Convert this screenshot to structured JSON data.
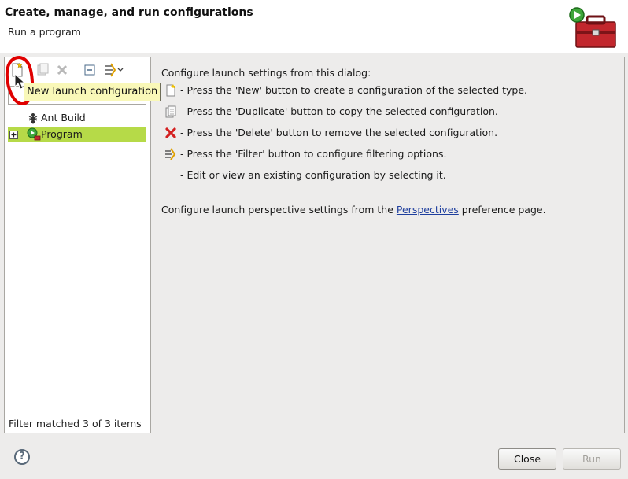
{
  "header": {
    "title": "Create, manage, and run configurations",
    "subtitle": "Run a program"
  },
  "toolbar": {
    "tooltip": "New launch configuration",
    "icons": [
      "new-config-icon",
      "duplicate-icon",
      "delete-icon",
      "collapse-all-icon",
      "filter-icon"
    ]
  },
  "tree": {
    "items": [
      {
        "label": "Ant Build",
        "icon": "ant-icon",
        "selected": false
      },
      {
        "label": "Program",
        "icon": "program-launch-icon",
        "selected": true,
        "expandable": true
      }
    ],
    "filter_status": "Filter matched 3 of 3 items"
  },
  "info": {
    "intro": "Configure launch settings from this dialog:",
    "lines": [
      {
        "icon": "new-icon",
        "text": "- Press the 'New' button to create a configuration of the selected type."
      },
      {
        "icon": "duplicate-icon",
        "text": "- Press the 'Duplicate' button to copy the selected configuration."
      },
      {
        "icon": "delete-icon",
        "text": "- Press the 'Delete' button to remove the selected configuration."
      },
      {
        "icon": "filter-icon",
        "text": "- Press the 'Filter' button to configure filtering options."
      },
      {
        "icon": "",
        "text": "- Edit or view an existing configuration by selecting it."
      }
    ],
    "perspective_prefix": "Configure launch perspective settings from the ",
    "perspective_link": "Perspectives",
    "perspective_suffix": " preference page."
  },
  "footer": {
    "help": "?",
    "close_label": "Close",
    "run_label": "Run"
  },
  "colors": {
    "selection": "#b6da48",
    "link": "#1f3f9e",
    "tooltip_bg": "#f9f8b8",
    "annotation": "#e00000"
  }
}
